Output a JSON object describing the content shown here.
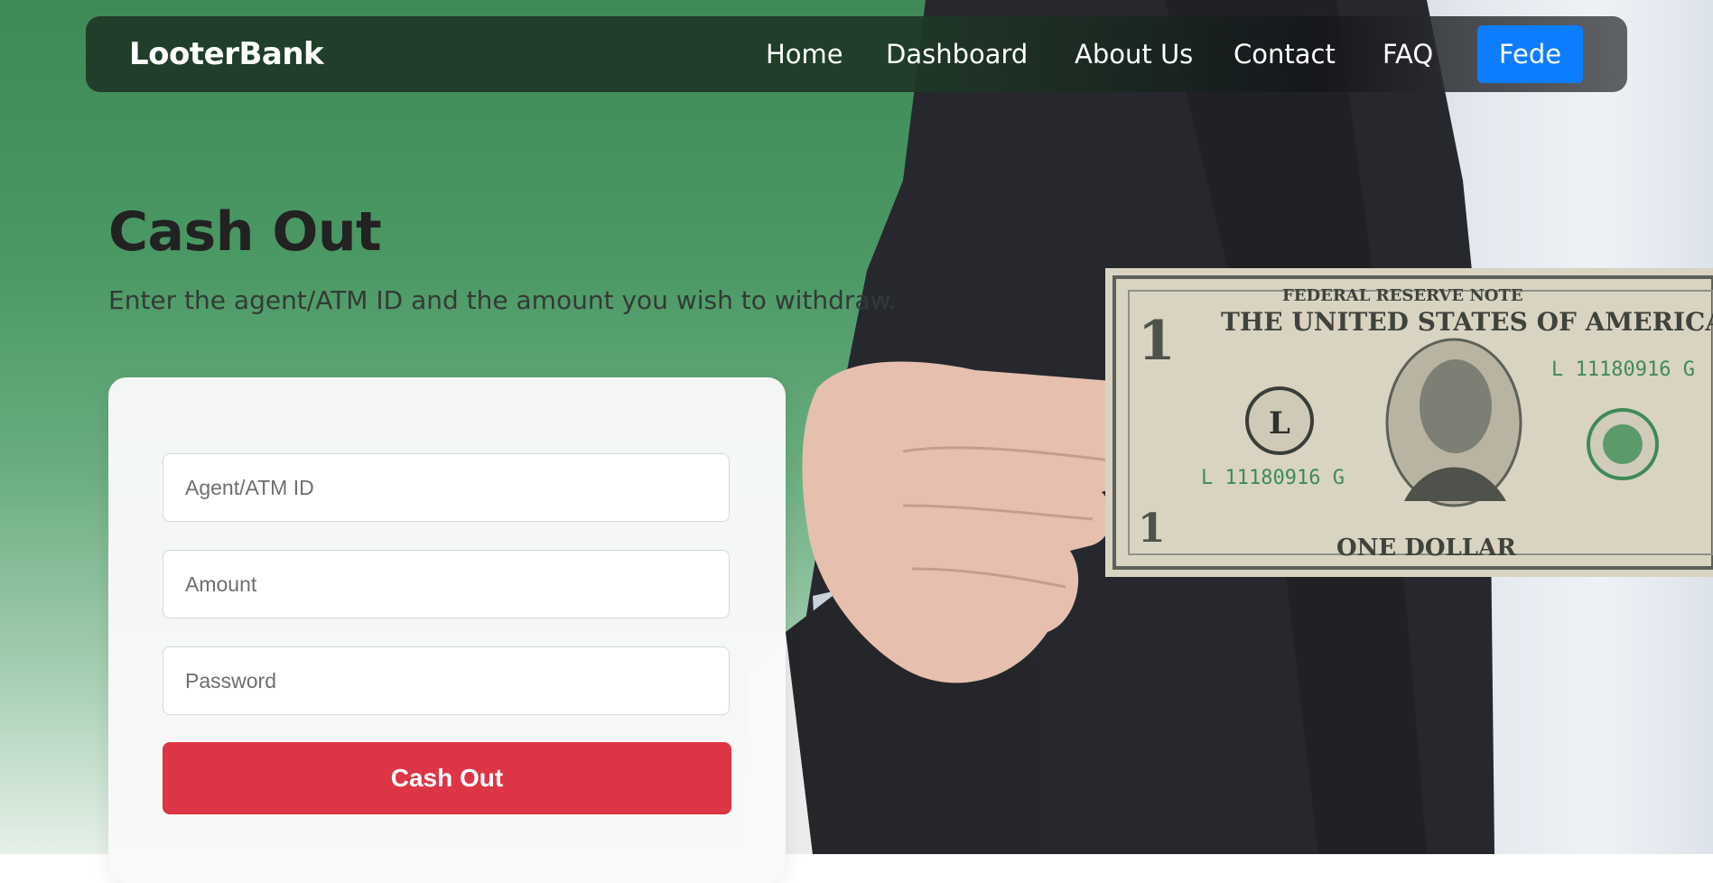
{
  "brand": "LooterBank",
  "nav": {
    "links": [
      "Home",
      "Dashboard",
      "About Us",
      "Contact",
      "FAQ"
    ],
    "user": "Fede"
  },
  "hero": {
    "title": "Cash Out",
    "subtitle": "Enter the agent/ATM ID and the amount you wish to withdraw."
  },
  "form": {
    "agent_placeholder": "Agent/ATM ID",
    "amount_placeholder": "Amount",
    "password_placeholder": "Password",
    "submit_label": "Cash Out"
  },
  "colors": {
    "accent_green": "#3f8a57",
    "user_button": "#0d7dff",
    "submit_button": "#dc3545"
  }
}
